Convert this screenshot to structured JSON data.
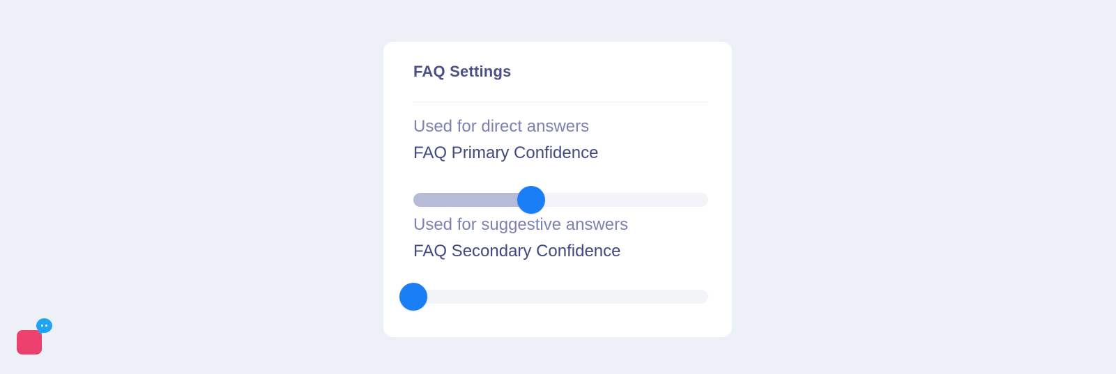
{
  "faq_settings": {
    "title": "FAQ Settings",
    "primary": {
      "help_text": "Used for direct answers",
      "label": "FAQ Primary Confidence",
      "value_fraction": 0.4
    },
    "secondary": {
      "help_text": "Used for suggestive answers",
      "label": "FAQ Secondary Confidence",
      "value_fraction": 0.0
    }
  },
  "colors": {
    "page_background": "#eef0f7",
    "card_background": "#ffffff",
    "title": "#4a5186",
    "help_text": "#7c82b0",
    "label_text": "#414a80",
    "slider_track": "#f3f4f7",
    "slider_fill": "#b6bbd8",
    "slider_thumb": "#1a7ef6",
    "chat_widget_primary": "#ef426f",
    "chat_widget_bubble": "#1fa3f3"
  },
  "chat_widget": {
    "icon": "chat-bubble-icon"
  }
}
